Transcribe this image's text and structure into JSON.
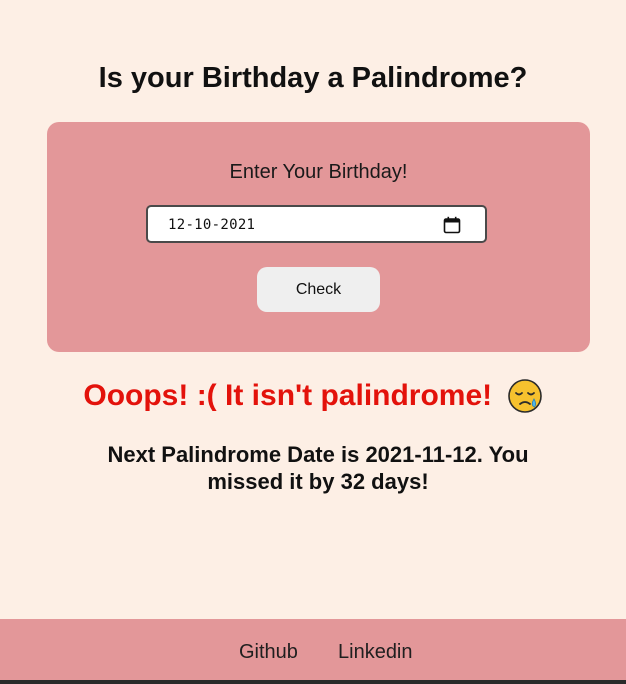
{
  "page": {
    "title": "Is your Birthday a Palindrome?"
  },
  "form": {
    "label": "Enter Your Birthday!",
    "date_value": "12-10-2021",
    "check_label": "Check"
  },
  "result": {
    "message": "Ooops! :( It isn't palindrome!",
    "emoji_icon": "sad-crying-face-icon",
    "next_date_text": "Next Palindrome Date is 2021-11-12. You missed it by 32 days!"
  },
  "footer": {
    "links": [
      "Github",
      "Linkedin"
    ]
  },
  "colors": {
    "background": "#fdefe5",
    "card": "#e39799",
    "error": "#e3120b",
    "footer": "#e39799"
  }
}
